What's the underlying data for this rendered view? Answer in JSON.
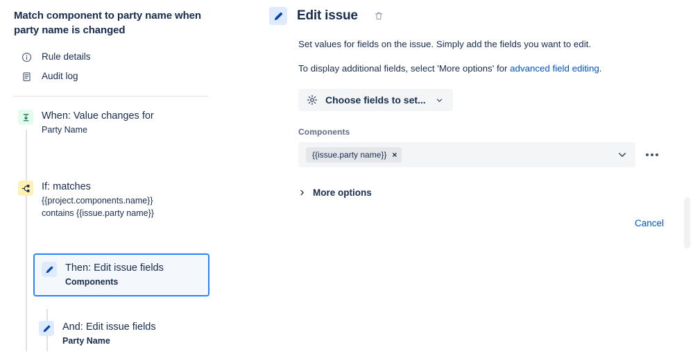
{
  "rule": {
    "title": "Match component to party name when party name is changed",
    "nav": [
      {
        "label": "Rule details",
        "icon": "info-circle-icon"
      },
      {
        "label": "Audit log",
        "icon": "document-list-icon"
      }
    ],
    "steps": [
      {
        "key": "when",
        "head": "When: Value changes for",
        "sub": "Party Name",
        "icon": "trigger-icon",
        "badge_color": "#E3FCEF",
        "selected": false
      },
      {
        "key": "if",
        "head": "If: matches",
        "sub": "{{project.components.name}}",
        "sub2": "contains {{issue.party name}}",
        "icon": "branch-icon",
        "badge_color": "#FFF0B3",
        "selected": false
      },
      {
        "key": "then",
        "head": "Then: Edit issue fields",
        "sub": "Components",
        "icon": "pencil-icon",
        "badge_color": "#DEEBFF",
        "selected": true
      },
      {
        "key": "and",
        "head": "And: Edit issue fields",
        "sub": "Party Name",
        "icon": "pencil-icon",
        "badge_color": "#DEEBFF",
        "selected": false
      }
    ]
  },
  "panel": {
    "title": "Edit issue",
    "delete_icon": "trash-icon",
    "header_icon": "pencil-icon",
    "description_1": "Set values for fields on the issue. Simply add the fields you want to edit.",
    "description_2_prefix": "To display additional fields, select 'More options' for ",
    "description_2_link": "advanced field editing",
    "description_2_suffix": ".",
    "choose_fields_button": "Choose fields to set...",
    "components": {
      "label": "Components",
      "chip_value": "{{issue.party name}}",
      "chip_remove": "×"
    },
    "more_options_label": "More options",
    "cancel_label": "Cancel"
  },
  "colors": {
    "accent_blue": "#0052CC",
    "selected_border": "#2684FF",
    "trigger_green": "#E3FCEF",
    "condition_yellow": "#FFF0B3",
    "action_blue": "#DEEBFF"
  }
}
